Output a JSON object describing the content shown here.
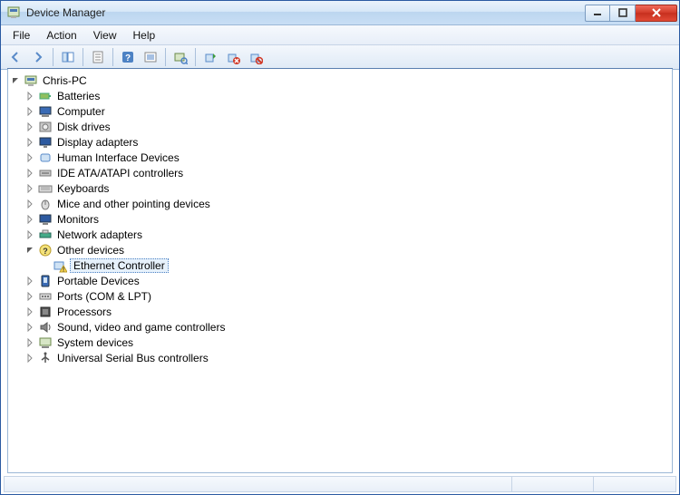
{
  "window": {
    "title": "Device Manager"
  },
  "menus": {
    "file": "File",
    "action": "Action",
    "view": "View",
    "help": "Help"
  },
  "root": {
    "label": "Chris-PC",
    "expanded": true
  },
  "categories": [
    {
      "label": "Batteries",
      "icon": "battery"
    },
    {
      "label": "Computer",
      "icon": "computer"
    },
    {
      "label": "Disk drives",
      "icon": "disk"
    },
    {
      "label": "Display adapters",
      "icon": "display"
    },
    {
      "label": "Human Interface Devices",
      "icon": "hid"
    },
    {
      "label": "IDE ATA/ATAPI controllers",
      "icon": "ide"
    },
    {
      "label": "Keyboards",
      "icon": "keyboard"
    },
    {
      "label": "Mice and other pointing devices",
      "icon": "mouse"
    },
    {
      "label": "Monitors",
      "icon": "monitor"
    },
    {
      "label": "Network adapters",
      "icon": "network"
    },
    {
      "label": "Other devices",
      "icon": "unknown",
      "expanded": true,
      "children": [
        {
          "label": "Ethernet Controller",
          "icon": "warning",
          "selected": true
        }
      ]
    },
    {
      "label": "Portable Devices",
      "icon": "portable"
    },
    {
      "label": "Ports (COM & LPT)",
      "icon": "port"
    },
    {
      "label": "Processors",
      "icon": "cpu"
    },
    {
      "label": "Sound, video and game controllers",
      "icon": "sound"
    },
    {
      "label": "System devices",
      "icon": "system"
    },
    {
      "label": "Universal Serial Bus controllers",
      "icon": "usb"
    }
  ]
}
